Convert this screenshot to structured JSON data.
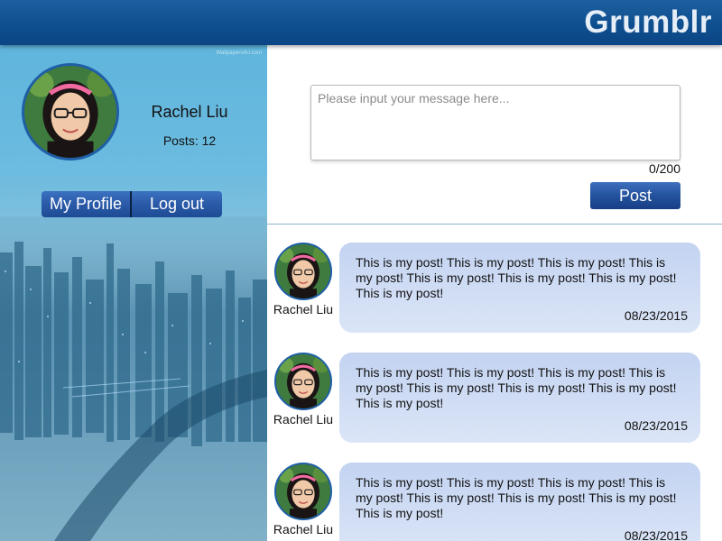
{
  "header": {
    "brand": "Grumblr"
  },
  "sidebar": {
    "user_name": "Rachel Liu",
    "posts_label": "Posts: 12",
    "my_profile_label": "My Profile",
    "logout_label": "Log out",
    "watermark": "Wallpapers4U.com"
  },
  "composer": {
    "placeholder": "Please input your message here...",
    "value": "",
    "counter": "0/200",
    "post_label": "Post"
  },
  "posts": [
    {
      "author": "Rachel Liu",
      "text": "This is my post! This is my post! This is my post! This is my post! This is my post! This is my post! This is my post! This is my post!",
      "date": "08/23/2015"
    },
    {
      "author": "Rachel Liu",
      "text": "This is my post! This is my post! This is my post! This is my post! This is my post! This is my post! This is my post! This is my post!",
      "date": "08/23/2015"
    },
    {
      "author": "Rachel Liu",
      "text": "This is my post! This is my post! This is my post! This is my post! This is my post! This is my post! This is my post! This is my post!",
      "date": "08/23/2015"
    }
  ],
  "colors": {
    "header": "#0f4f8f",
    "button": "#24529d",
    "bubble": "#c9d8f3",
    "avatar_border": "#1f5fa8"
  }
}
